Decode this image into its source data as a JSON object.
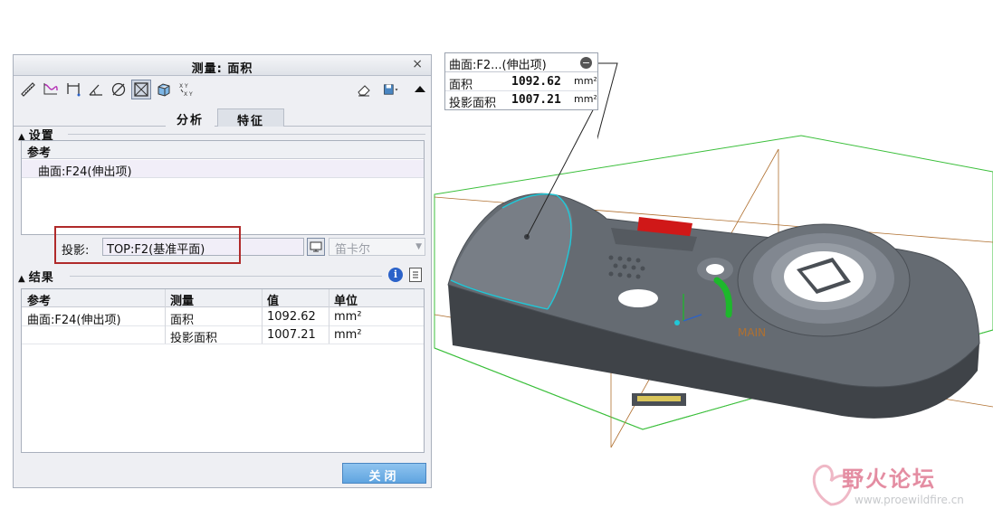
{
  "dialog": {
    "title": "测量: 面积",
    "close_glyph": "×",
    "tabs": [
      {
        "label": "分析"
      },
      {
        "label": "特征"
      }
    ],
    "settings": {
      "heading": "设置",
      "reference_header": "参考",
      "reference_item": "曲面:F24(伸出项)",
      "projection_label": "投影:",
      "projection_value": "TOP:F2(基准平面)",
      "coordinate_value": "笛卡尔"
    },
    "results": {
      "heading": "结果",
      "info_glyph": "i",
      "columns": [
        "参考",
        "测量",
        "值",
        "单位"
      ],
      "rows": [
        {
          "reference": "曲面:F24(伸出项)",
          "measure": "面积",
          "value": "1092.62",
          "unit": "mm²"
        },
        {
          "reference": "",
          "measure": "投影面积",
          "value": "1007.21",
          "unit": "mm²"
        }
      ]
    },
    "close_button": "关闭"
  },
  "annotation": {
    "title": "曲面:F2...(伸出项)",
    "minus_glyph": "−",
    "rows": [
      {
        "label": "面积",
        "value": "1092.62",
        "unit": "mm²"
      },
      {
        "label": "投影面积",
        "value": "1007.21",
        "unit": "mm²"
      }
    ]
  },
  "model": {
    "csys_label": "MAIN"
  },
  "watermark": {
    "name": "野火论坛",
    "url": "www.proewildfire.cn"
  },
  "colors": {
    "close_button": "#5fa4e0",
    "highlight_border": "#b02a2a",
    "datum_plane": "#3bbf3b",
    "datum_axis": "#b07030",
    "model_body": "#5d6268",
    "selected_edge": "#20c8d8",
    "red_part": "#d01818",
    "green_part": "#1db82c"
  },
  "icons": [
    "distance-icon",
    "length-icon",
    "length-along-icon",
    "angle-icon",
    "diameter-icon",
    "area-icon",
    "volume-icon",
    "transform-icon",
    "eraser-icon",
    "save-icon",
    "collapse-icon"
  ]
}
